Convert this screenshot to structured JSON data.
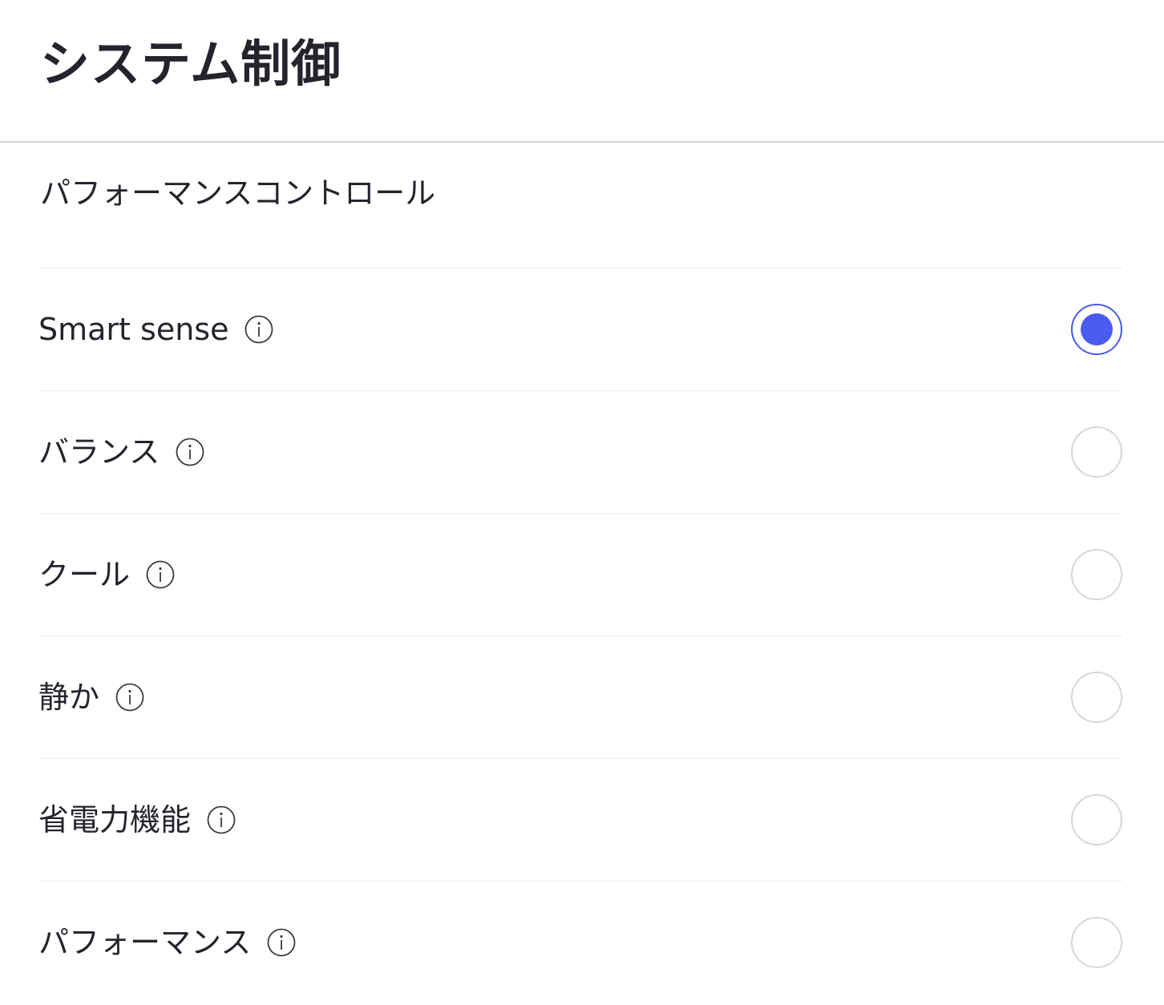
{
  "header": {
    "title": "システム制御"
  },
  "section": {
    "title": "パフォーマンスコントロール"
  },
  "options": [
    {
      "label": "Smart sense",
      "info_icon": "info-circle-icon",
      "selected": true
    },
    {
      "label": "バランス",
      "info_icon": "info-circle-icon",
      "selected": false
    },
    {
      "label": "クール",
      "info_icon": "info-circle-icon",
      "selected": false
    },
    {
      "label": "静か",
      "info_icon": "info-circle-icon",
      "selected": false
    },
    {
      "label": "省電力機能",
      "info_icon": "info-circle-icon",
      "selected": false
    },
    {
      "label": "パフォーマンス",
      "info_icon": "info-circle-icon",
      "selected": false
    }
  ],
  "colors": {
    "accent": "#4a5ae6",
    "accent_fill": "#4a5cf0",
    "text": "#24242e",
    "divider": "#ececf0",
    "radio_border": "#d6d6de"
  }
}
